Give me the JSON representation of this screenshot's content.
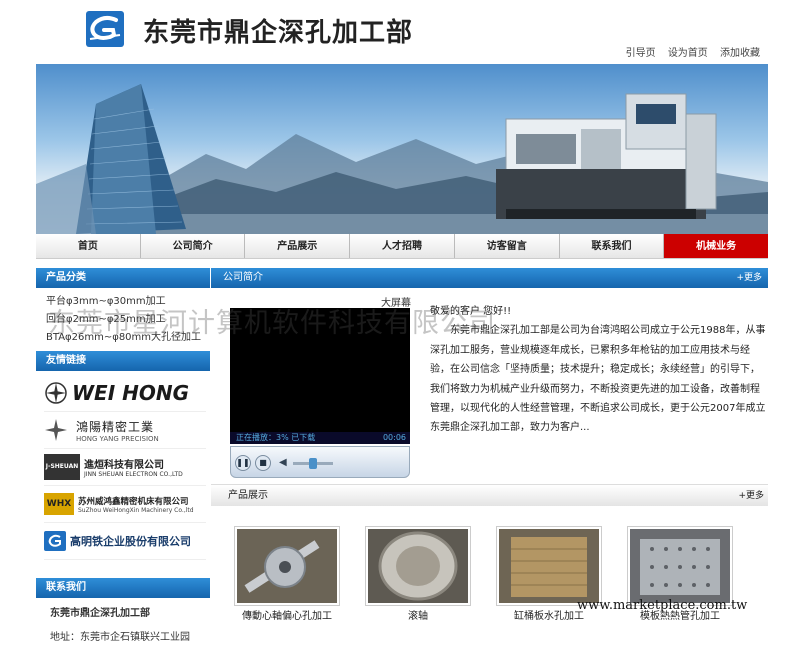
{
  "header": {
    "title": "东莞市鼎企深孔加工部",
    "links": [
      "引导页",
      "设为首页",
      "添加收藏"
    ]
  },
  "nav": {
    "items": [
      "首页",
      "公司简介",
      "产品展示",
      "人才招聘",
      "访客留言",
      "联系我们",
      "机械业务"
    ],
    "active_index": 6
  },
  "sidebar": {
    "category_title": "产品分类",
    "categories": [
      "平台φ3mm~φ30mm加工",
      "回台φ2mm~φ25mm加工",
      "BTAφ26mm~φ80mm大孔径加工"
    ],
    "links_title": "友情链接",
    "partners": [
      {
        "name": "WEI HONG"
      },
      {
        "name": "鴻陽精密工業",
        "sub": "HONG YANG PRECISION"
      },
      {
        "badge": "J-SHEUAN",
        "name": "進烜科技有限公司",
        "sub": "JINN SHEUAN ELECTRON CO.,LTD"
      },
      {
        "badge": "WHX",
        "name": "苏州威鸿鑫精密机床有限公司",
        "sub": "SuZhou WeiHongXin Machinery Co.,ltd"
      },
      {
        "name": "高明铁企业股份有限公司"
      }
    ],
    "contact_title": "联系我们",
    "contact_company": "东莞市鼎企深孔加工部",
    "contact_address": "地址：东莞市企石镇联兴工业园"
  },
  "main": {
    "intro_title": "公司简介",
    "more": "+更多",
    "player_label": "大屏幕",
    "player_status": "正在播放：3% 已下载",
    "player_time": "00:06",
    "greeting": "敬爱的客户 您好!!",
    "intro_text": "东莞市鼎企深孔加工部是公司为台湾鸿昭公司成立于公元1988年，从事深孔加工服务，营业规模逐年成长，已累积多年枪钻的加工应用技术与经验，在公司信念「坚持质量；技术提升；稳定成长；永续经营」的引导下，我们将致力为机械产业升级而努力，不断投资更先进的加工设备，改善制程管理，以现代化的人性经营管理，不断追求公司成长，更于公元2007年成立东莞鼎企深孔加工部，致力为客户...",
    "products_title": "产品展示",
    "products": [
      "傳動心軸偏心孔加工",
      "滚轴",
      "缸桶板水孔加工",
      "模板熱熱管孔加工"
    ]
  },
  "watermark": "东莞市星河计算机软件科技有限公司",
  "footer_mark": "www.marketplace.com.tw",
  "colors": {
    "accent_blue": "#1f6fc0",
    "nav_active": "#cc0000"
  }
}
